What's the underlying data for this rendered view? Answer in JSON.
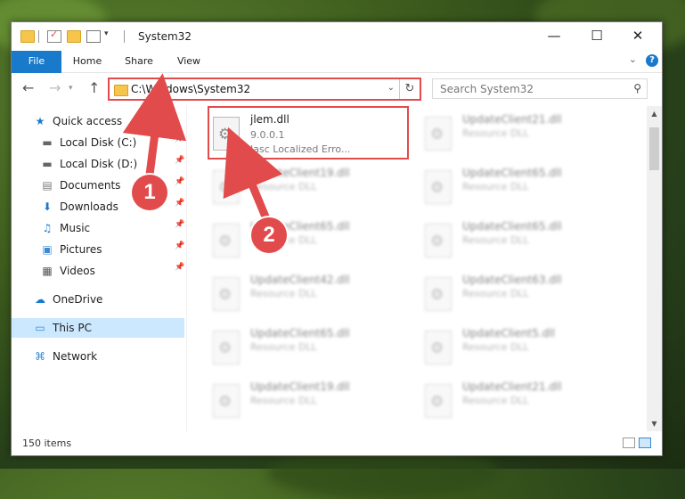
{
  "window": {
    "title": "System32",
    "minimize_glyph": "—",
    "maximize_glyph": "☐",
    "close_glyph": "✕"
  },
  "ribbon": {
    "tabs": [
      "File",
      "Home",
      "Share",
      "View"
    ],
    "help_glyph": "?",
    "collapse_glyph": "⌄"
  },
  "nav": {
    "address": "C:\\Windows\\System32",
    "search_placeholder": "Search System32"
  },
  "sidebar": {
    "items": [
      {
        "label": "Quick access",
        "icon": "star-icon",
        "glyph": "★",
        "color": "#1979ca"
      },
      {
        "label": "Local Disk (C:)",
        "icon": "drive-icon",
        "glyph": "▬",
        "color": "#666666"
      },
      {
        "label": "Local Disk (D:)",
        "icon": "drive-icon",
        "glyph": "▬",
        "color": "#666666"
      },
      {
        "label": "Documents",
        "icon": "documents-icon",
        "glyph": "▤",
        "color": "#7a7a7a"
      },
      {
        "label": "Downloads",
        "icon": "downloads-icon",
        "glyph": "⬇",
        "color": "#1979ca"
      },
      {
        "label": "Music",
        "icon": "music-icon",
        "glyph": "♫",
        "color": "#1979ca"
      },
      {
        "label": "Pictures",
        "icon": "pictures-icon",
        "glyph": "▣",
        "color": "#3c89d1"
      },
      {
        "label": "Videos",
        "icon": "videos-icon",
        "glyph": "▦",
        "color": "#555555"
      },
      {
        "label": "OneDrive",
        "icon": "onedrive-icon",
        "glyph": "☁",
        "color": "#1979ca"
      },
      {
        "label": "This PC",
        "icon": "pc-icon",
        "glyph": "▭",
        "color": "#3c89d1"
      },
      {
        "label": "Network",
        "icon": "network-icon",
        "glyph": "⌘",
        "color": "#3c89d1"
      }
    ]
  },
  "files": {
    "highlighted": {
      "name": "jlem.dll",
      "version": "9.0.0.1",
      "desc": "Jasc Localized Erro..."
    },
    "blurred": [
      {
        "name": "UpdateClient21.dll",
        "desc": "Resource DLL"
      },
      {
        "name": "UpdateClient19.dll",
        "desc": "Resource DLL"
      },
      {
        "name": "UpdateClient65.dll",
        "desc": "Resource DLL"
      },
      {
        "name": "UpdateClient65.dll",
        "desc": "Resource DLL"
      },
      {
        "name": "UpdateClient65.dll",
        "desc": "Resource DLL"
      },
      {
        "name": "UpdateClient42.dll",
        "desc": "Resource DLL"
      },
      {
        "name": "UpdateClient63.dll",
        "desc": "Resource DLL"
      },
      {
        "name": "UpdateClient65.dll",
        "desc": "Resource DLL"
      },
      {
        "name": "UpdateClient5.dll",
        "desc": "Resource DLL"
      },
      {
        "name": "UpdateClient19.dll",
        "desc": "Resource DLL"
      },
      {
        "name": "UpdateClient21.dll",
        "desc": "Resource DLL"
      }
    ]
  },
  "status": {
    "count": "150 items"
  },
  "callouts": [
    "1",
    "2"
  ],
  "colors": {
    "accent": "#1979ca",
    "callout": "#e24b4b",
    "selection": "#cce8ff"
  }
}
